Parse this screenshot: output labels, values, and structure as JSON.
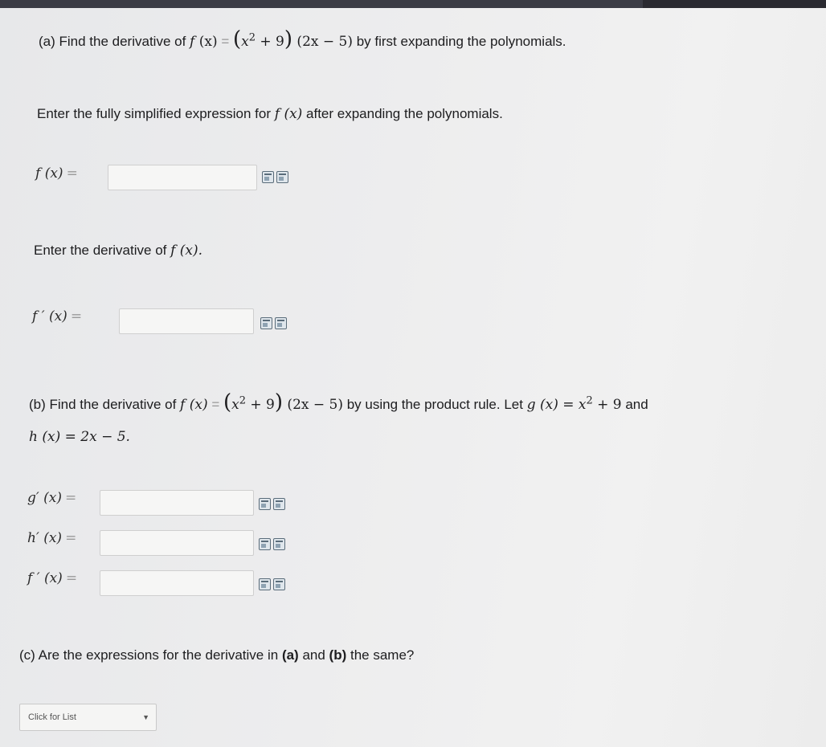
{
  "part_a": {
    "prefix": "(a) Find the derivative of ",
    "func": "f",
    "var": "(x)",
    "eq": " = ",
    "expr_open": "(",
    "expr_inner": "x",
    "expr_exp": "2",
    "expr_plus": " + 9",
    "expr_close": ")",
    "expr_factor": " (2x − 5)",
    "suffix": " by first expanding the polynomials.",
    "instruction_text": "Enter the fully simplified expression for ",
    "instruction_func": "f (x)",
    "instruction_suffix": " after expanding the polynomials.",
    "f_label": "f (x)",
    "deriv_instruction": "Enter the derivative of ",
    "deriv_instruction_func": "f (x).",
    "fprime_label": "f ′ (x)"
  },
  "part_b": {
    "prefix": "(b) Find the derivative of ",
    "func_text": "f (x)",
    "eq": " = ",
    "expr_open": "(",
    "expr_inner": "x",
    "expr_exp": "2",
    "expr_plus": " + 9",
    "expr_close": ")",
    "expr_factor": " (2x − 5)",
    "middle": " by using the product rule. Let ",
    "g_def": "g (x) = x",
    "g_exp": "2",
    "g_tail": " + 9",
    "and": " and",
    "h_def": "h (x) = 2x − 5.",
    "gprime_label": "g′ (x)",
    "hprime_label": "h′ (x)",
    "fprime_label": "f ′ (x)"
  },
  "part_c": {
    "question_prefix": "(c) Are the expressions for the derivative in ",
    "a_bold": "(a)",
    "and": " and ",
    "b_bold": "(b)",
    "question_suffix": " the same?",
    "select_placeholder": "Click for List"
  },
  "equals": "=",
  "fields": {
    "f_value": "",
    "fprime_a_value": "",
    "gprime_value": "",
    "hprime_value": "",
    "fprime_b_value": ""
  },
  "icons": [
    "math-editor-icon",
    "preview-icon"
  ]
}
